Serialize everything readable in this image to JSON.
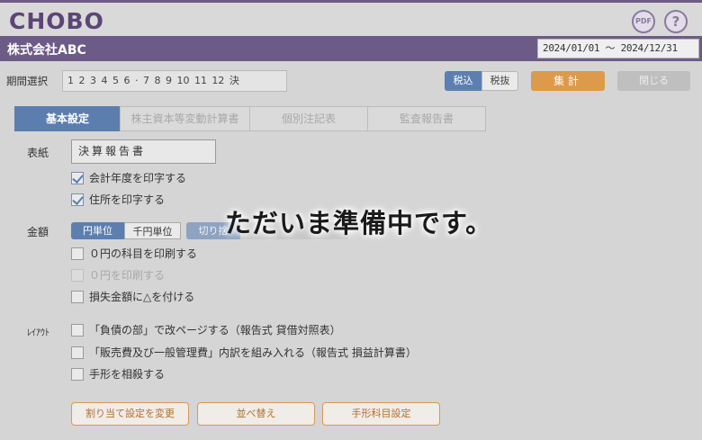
{
  "app": {
    "logo_text": "CHOBO"
  },
  "header": {
    "company_name": "株式会社ABC",
    "period": "2024/01/01 〜 2024/12/31",
    "pdf_icon_label": "PDF",
    "help_icon_label": "?"
  },
  "toolbar": {
    "period_select_label": "期間選択",
    "months": "1 2 3 4 5 6 · 7 8 9 10 11 12 決",
    "tax_included": "税込",
    "tax_excluded": "税抜",
    "calculate": "集計",
    "close": "閉じる"
  },
  "tabs": [
    {
      "label": "基本設定",
      "active": true
    },
    {
      "label": "株主資本等変動計算書",
      "active": false
    },
    {
      "label": "個別注記表",
      "active": false
    },
    {
      "label": "監査報告書",
      "active": false
    }
  ],
  "cover": {
    "label": "表紙",
    "title_value": "決算報告書",
    "options": [
      {
        "label": "会計年度を印字する",
        "checked": true
      },
      {
        "label": "住所を印字する",
        "checked": true
      }
    ]
  },
  "amount": {
    "label": "金額",
    "unit_yen": "円単位",
    "unit_thousand": "千円単位",
    "rounding": "切り捨",
    "options": [
      {
        "label": "０円の科目を印刷する",
        "checked": false,
        "disabled": false
      },
      {
        "label": "０円を印刷する",
        "checked": false,
        "disabled": true
      },
      {
        "label": "損失金額に△を付ける",
        "checked": false,
        "disabled": false
      }
    ]
  },
  "layout": {
    "label": "ﾚｲｱｳﾄ",
    "options": [
      {
        "label": "「負債の部」で改ページする（報告式 貸借対照表）",
        "checked": false
      },
      {
        "label": "「販売費及び一般管理費」内訳を組み入れる（報告式 損益計算書）",
        "checked": false
      },
      {
        "label": "手形を相殺する",
        "checked": false
      }
    ]
  },
  "actions": {
    "change_allocation": "割り当て設定を変更",
    "reorder": "並べ替え",
    "bill_account_setting": "手形科目設定"
  },
  "overlay_message": "ただいま準備中です。",
  "colors": {
    "brand_purple": "#6d5b87",
    "accent_blue": "#5d7fb0",
    "accent_orange": "#dd9a4b"
  }
}
